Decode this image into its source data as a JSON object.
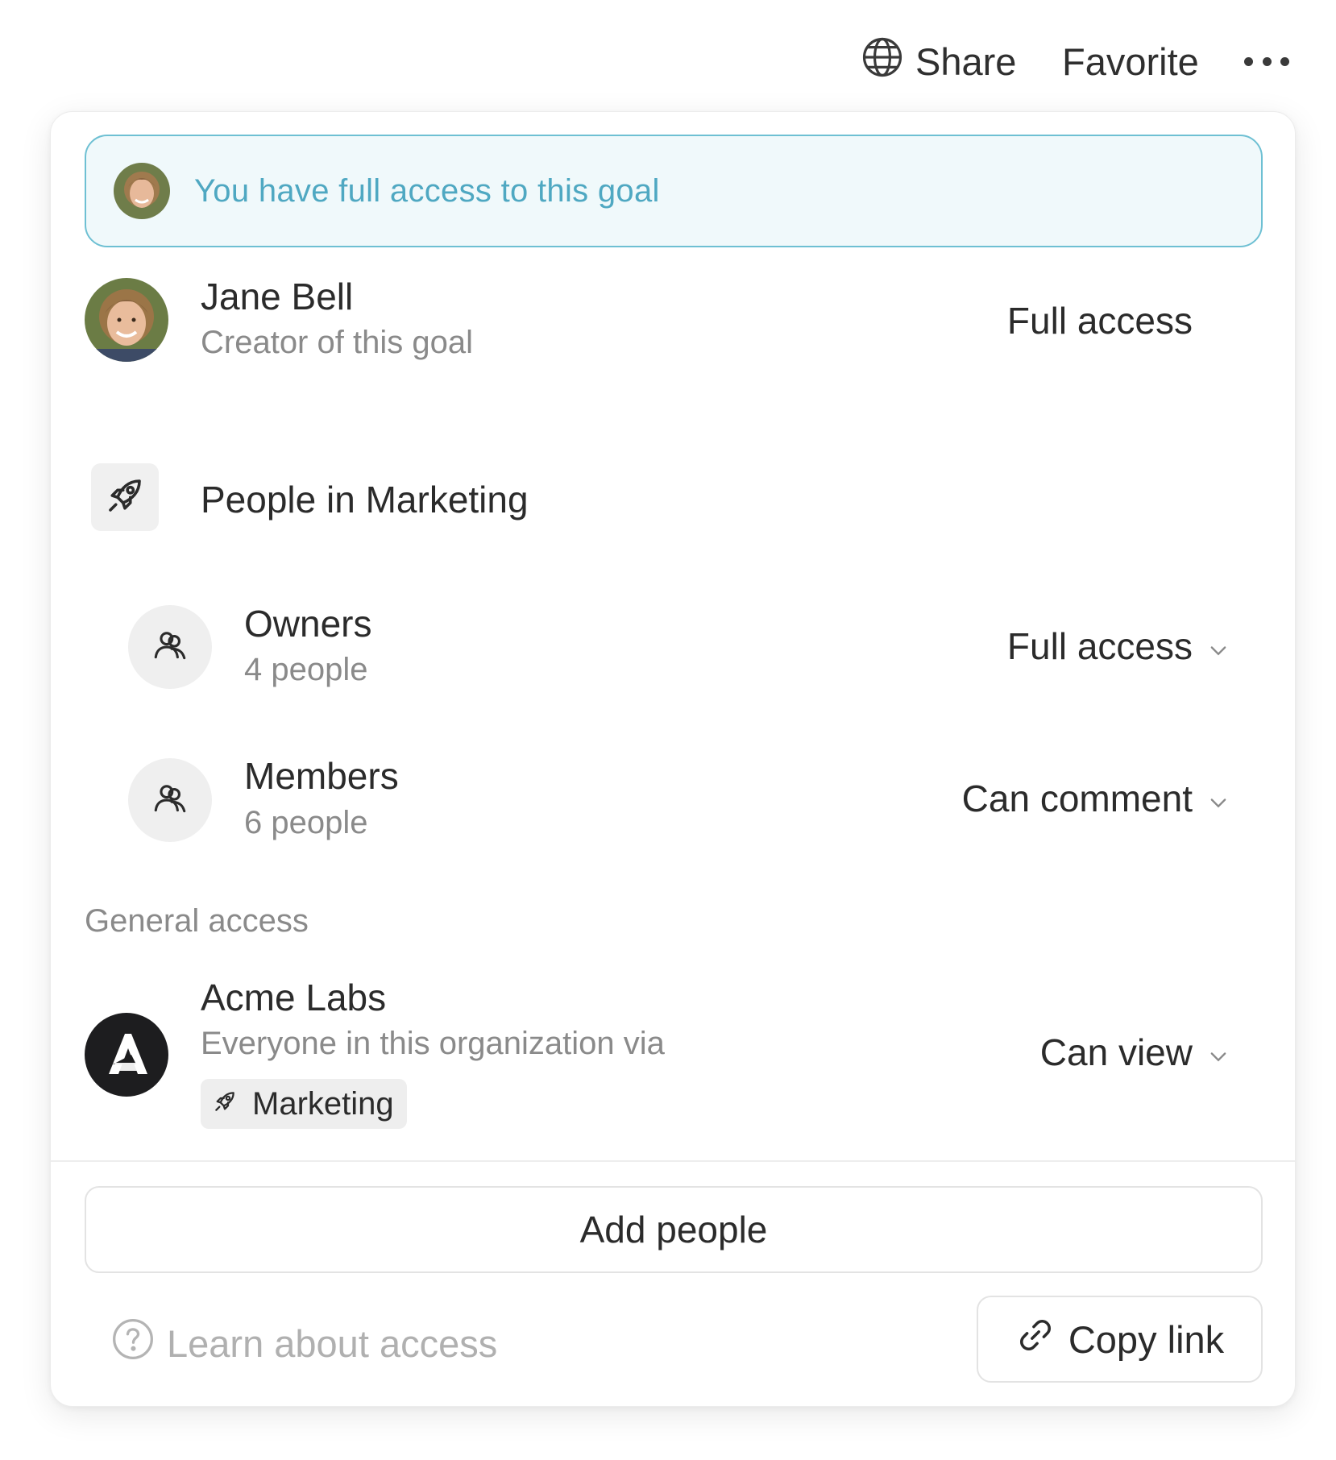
{
  "topbar": {
    "share_label": "Share",
    "favorite_label": "Favorite"
  },
  "banner": {
    "text": "You have full access to this goal"
  },
  "creator": {
    "name": "Jane Bell",
    "role": "Creator of this goal",
    "permission": "Full access"
  },
  "team": {
    "name": "People in Marketing",
    "groups": [
      {
        "name": "Owners",
        "count": "4 people",
        "permission": "Full access"
      },
      {
        "name": "Members",
        "count": "6 people",
        "permission": "Can comment"
      }
    ]
  },
  "general_access": {
    "heading": "General access",
    "org_name": "Acme Labs",
    "description": "Everyone in this organization via",
    "chip_label": "Marketing",
    "permission": "Can view"
  },
  "footer": {
    "add_people_label": "Add people",
    "learn_label": "Learn about access",
    "copy_link_label": "Copy link"
  },
  "colors": {
    "banner_border": "#6ec0d3",
    "banner_background": "#f0f9fb",
    "banner_text": "#4fa8c2",
    "org_logo": "#1d1d1f"
  },
  "icons": {
    "share": "globe-icon",
    "more": "ellipsis-icon",
    "team": "rocket-icon",
    "group": "people-icon",
    "dropdown": "chevron-down-icon",
    "help": "question-circle-icon",
    "link": "link-icon"
  }
}
